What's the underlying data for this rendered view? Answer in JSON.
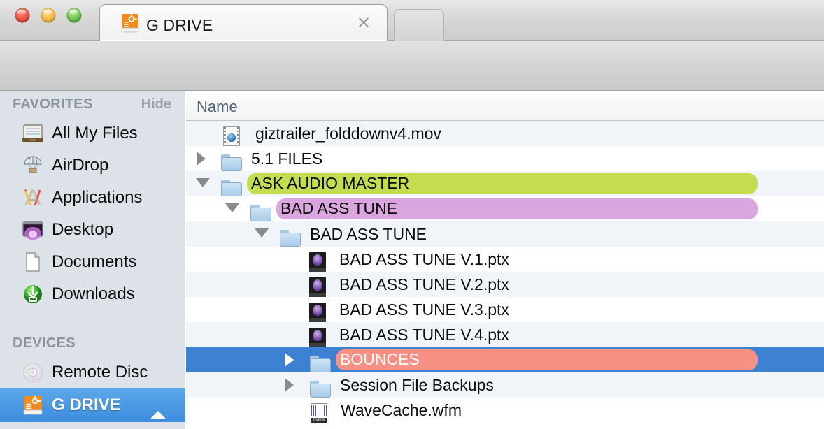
{
  "window": {
    "traffic_lights": [
      "close",
      "minimize",
      "zoom"
    ],
    "tab": {
      "title": "G DRIVE",
      "icon": "external-drive-icon",
      "close_label": "×"
    }
  },
  "toolbar": {
    "back_icon": "back-arrow-icon",
    "forward_icon": "forward-arrow-icon",
    "views": [
      {
        "name": "icon-view",
        "icon": "grid-icon",
        "active": false
      },
      {
        "name": "list-view",
        "icon": "list-icon",
        "active": true
      },
      {
        "name": "column-view",
        "icon": "columns-icon",
        "active": false
      },
      {
        "name": "coverflow-view",
        "icon": "coverflow-icon",
        "active": false
      }
    ],
    "arrange_icon": "arrange-grid-icon",
    "action_icon": "gear-icon",
    "share_icon": "share-icon",
    "tags_icon": "tag-toggle-icon",
    "search": {
      "icon": "search-icon",
      "value": "",
      "placeholder": ""
    }
  },
  "sidebar": {
    "sections": [
      {
        "title": "FAVORITES",
        "action": "Hide",
        "items": [
          {
            "label": "All My Files",
            "icon": "all-my-files-icon",
            "selected": false
          },
          {
            "label": "AirDrop",
            "icon": "airdrop-icon",
            "selected": false
          },
          {
            "label": "Applications",
            "icon": "applications-icon",
            "selected": false
          },
          {
            "label": "Desktop",
            "icon": "desktop-icon",
            "selected": false
          },
          {
            "label": "Documents",
            "icon": "documents-icon",
            "selected": false
          },
          {
            "label": "Downloads",
            "icon": "downloads-icon",
            "selected": false
          }
        ]
      },
      {
        "title": "DEVICES",
        "action": "",
        "items": [
          {
            "label": "Remote Disc",
            "icon": "optical-disc-icon",
            "selected": false
          },
          {
            "label": "G DRIVE",
            "icon": "external-drive-icon",
            "selected": true,
            "eject": true
          }
        ]
      }
    ]
  },
  "filelist": {
    "columns": [
      {
        "label": "Name",
        "sorted": true,
        "sort_direction": "ascending"
      },
      {
        "label": "",
        "sorted": false
      }
    ],
    "rows": [
      {
        "name": "giztrailer_folddownv4.mov",
        "icon": "movie-file-icon",
        "depth": 0,
        "twisty": "none",
        "tag": "",
        "selected": false,
        "stripe": "even",
        "size": ""
      },
      {
        "name": "5.1 FILES",
        "icon": "folder-icon",
        "depth": 0,
        "twisty": "collapsed",
        "tag": "",
        "selected": false,
        "stripe": "odd",
        "size": "--"
      },
      {
        "name": "ASK AUDIO MASTER",
        "icon": "folder-icon",
        "depth": 0,
        "twisty": "expanded",
        "tag": "#c3dd4e",
        "selected": false,
        "stripe": "even",
        "size": "--"
      },
      {
        "name": "BAD ASS TUNE",
        "icon": "folder-icon",
        "depth": 1,
        "twisty": "expanded",
        "tag": "#dba5e0",
        "selected": false,
        "stripe": "odd",
        "size": "--"
      },
      {
        "name": "BAD ASS TUNE",
        "icon": "folder-icon",
        "depth": 2,
        "twisty": "expanded",
        "tag": "",
        "selected": false,
        "stripe": "even",
        "size": "--"
      },
      {
        "name": "BAD ASS TUNE V.1.ptx",
        "icon": "protools-session-icon",
        "depth": 3,
        "twisty": "none",
        "tag": "",
        "selected": false,
        "stripe": "odd",
        "size": "--"
      },
      {
        "name": "BAD ASS TUNE V.2.ptx",
        "icon": "protools-session-icon",
        "depth": 3,
        "twisty": "none",
        "tag": "",
        "selected": false,
        "stripe": "even",
        "size": "--"
      },
      {
        "name": "BAD ASS TUNE V.3.ptx",
        "icon": "protools-session-icon",
        "depth": 3,
        "twisty": "none",
        "tag": "",
        "selected": false,
        "stripe": "odd",
        "size": "--"
      },
      {
        "name": "BAD ASS TUNE V.4.ptx",
        "icon": "protools-session-icon",
        "depth": 3,
        "twisty": "none",
        "tag": "",
        "selected": false,
        "stripe": "even",
        "size": "--"
      },
      {
        "name": "BOUNCES",
        "icon": "folder-icon",
        "depth": 2,
        "twisty": "collapsed",
        "tag": "#f79183",
        "selected": true,
        "stripe": "odd",
        "size": "--"
      },
      {
        "name": "Session File Backups",
        "icon": "folder-icon",
        "depth": 2,
        "twisty": "collapsed",
        "tag": "",
        "selected": false,
        "stripe": "even",
        "size": "--"
      },
      {
        "name": "WaveCache.wfm",
        "icon": "wavecache-icon",
        "depth": 3,
        "twisty": "none",
        "tag": "",
        "selected": false,
        "stripe": "odd",
        "size": "--"
      }
    ]
  },
  "colors": {
    "selection_blue": "#3d82d2",
    "sidebar_selection": "#4a95e0",
    "tag_green": "#c3dd4e",
    "tag_purple": "#dba5e0",
    "tag_red": "#f79183",
    "sidebar_bg": "#dde2e9",
    "row_stripe": "#f1f5f9"
  }
}
